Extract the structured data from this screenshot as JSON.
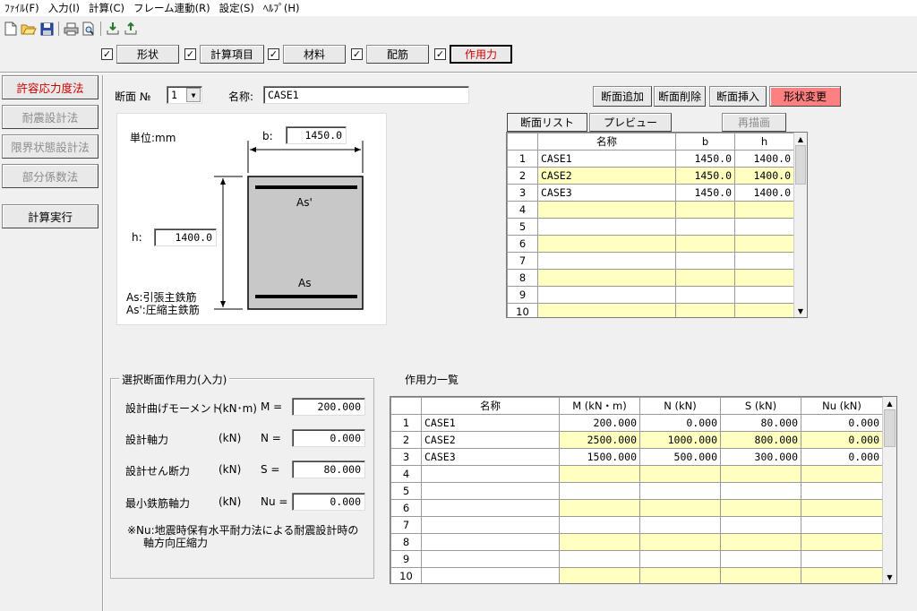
{
  "menu": [
    "ﾌｧｲﾙ(F)",
    "入力(I)",
    "計算(C)",
    "フレーム連動(R)",
    "設定(S)",
    "ﾍﾙﾌﾟ(H)"
  ],
  "toolbar_icons": [
    "new-file-icon",
    "open-folder-icon",
    "save-icon",
    "print-icon",
    "print-preview-icon",
    "import-icon",
    "export-icon"
  ],
  "tabs": [
    {
      "label": "形状",
      "checked": true
    },
    {
      "label": "計算項目",
      "checked": true
    },
    {
      "label": "材料",
      "checked": true
    },
    {
      "label": "配筋",
      "checked": true
    },
    {
      "label": "作用力",
      "checked": true
    }
  ],
  "methods": {
    "allowable": "許容応力度法",
    "seismic": "耐震設計法",
    "limit_state": "限界状態設計法",
    "partial_factor": "部分係数法",
    "run": "計算実行"
  },
  "section": {
    "no_label": "断面 №",
    "no_value": "1",
    "name_label": "名称:",
    "name_value": "CASE1"
  },
  "section_buttons": {
    "add": "断面追加",
    "delete": "断面削除",
    "insert": "断面挿入",
    "shape_change": "形状変更"
  },
  "diagram": {
    "unit": "単位:mm",
    "b_label": "b:",
    "b_value": "1450.0",
    "h_label": "h:",
    "h_value": "1400.0",
    "as_top": "As'",
    "as_bottom": "As",
    "legend1": "As:引張主鉄筋",
    "legend2": "As':圧縮主鉄筋"
  },
  "list_tabs": {
    "list": "断面リスト",
    "preview": "プレビュー",
    "redraw": "再描画"
  },
  "section_list": {
    "headers": [
      "名称",
      "b",
      "h"
    ],
    "rows": [
      {
        "no": "1",
        "name": "CASE1",
        "b": "1450.0",
        "h": "1400.0"
      },
      {
        "no": "2",
        "name": "CASE2",
        "b": "1450.0",
        "h": "1400.0"
      },
      {
        "no": "3",
        "name": "CASE3",
        "b": "1450.0",
        "h": "1400.0"
      },
      {
        "no": "4",
        "name": "",
        "b": "",
        "h": ""
      },
      {
        "no": "5",
        "name": "",
        "b": "",
        "h": ""
      },
      {
        "no": "6",
        "name": "",
        "b": "",
        "h": ""
      },
      {
        "no": "7",
        "name": "",
        "b": "",
        "h": ""
      },
      {
        "no": "8",
        "name": "",
        "b": "",
        "h": ""
      },
      {
        "no": "9",
        "name": "",
        "b": "",
        "h": ""
      },
      {
        "no": "10",
        "name": "",
        "b": "",
        "h": ""
      }
    ]
  },
  "force_input": {
    "title": "選択断面作用力(入力)",
    "rows": [
      {
        "label": "設計曲げモーメント",
        "unit": "(kN･m)",
        "symbol": "M =",
        "value": "200.000"
      },
      {
        "label": "設計軸力",
        "unit": "(kN)",
        "symbol": "N =",
        "value": "0.000"
      },
      {
        "label": "設計せん断力",
        "unit": "(kN)",
        "symbol": "S =",
        "value": "80.000"
      },
      {
        "label": "最小鉄筋軸力",
        "unit": "(kN)",
        "symbol": "Nu =",
        "value": "0.000"
      }
    ],
    "note1": "※Nu:地震時保有水平耐力法による耐震設計時の",
    "note2": "軸方向圧縮力"
  },
  "force_list": {
    "title": "作用力一覧",
    "headers": [
      "名称",
      "M (kN・m)",
      "N (kN)",
      "S (kN)",
      "Nu (kN)"
    ],
    "rows": [
      {
        "no": "1",
        "name": "CASE1",
        "m": "200.000",
        "n": "0.000",
        "s": "80.000",
        "nu": "0.000"
      },
      {
        "no": "2",
        "name": "CASE2",
        "m": "2500.000",
        "n": "1000.000",
        "s": "800.000",
        "nu": "0.000"
      },
      {
        "no": "3",
        "name": "CASE3",
        "m": "1500.000",
        "n": "500.000",
        "s": "300.000",
        "nu": "0.000"
      },
      {
        "no": "4",
        "name": "",
        "m": "",
        "n": "",
        "s": "",
        "nu": ""
      },
      {
        "no": "5",
        "name": "",
        "m": "",
        "n": "",
        "s": "",
        "nu": ""
      },
      {
        "no": "6",
        "name": "",
        "m": "",
        "n": "",
        "s": "",
        "nu": ""
      },
      {
        "no": "7",
        "name": "",
        "m": "",
        "n": "",
        "s": "",
        "nu": ""
      },
      {
        "no": "8",
        "name": "",
        "m": "",
        "n": "",
        "s": "",
        "nu": ""
      },
      {
        "no": "9",
        "name": "",
        "m": "",
        "n": "",
        "s": "",
        "nu": ""
      },
      {
        "no": "10",
        "name": "",
        "m": "",
        "n": "",
        "s": "",
        "nu": ""
      }
    ]
  },
  "colors": {
    "accent_red": "#cc0000",
    "shape_change_bg": "#ff8080",
    "yellow_row": "#ffffc0",
    "section_fill": "#c8c8c8"
  }
}
